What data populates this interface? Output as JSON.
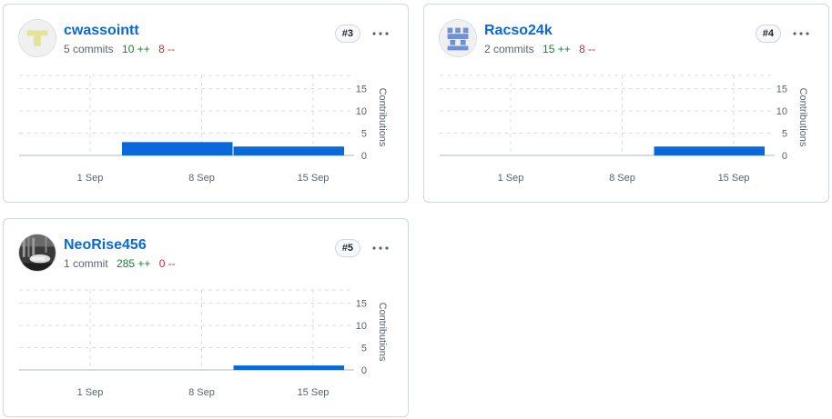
{
  "x_ticks": [
    "1 Sep",
    "8 Sep",
    "15 Sep"
  ],
  "y_ticks": [
    0,
    5,
    10,
    15
  ],
  "y_axis_title": "Contributions",
  "ylim": [
    0,
    18
  ],
  "colors": {
    "bar": "#0969da",
    "link": "#0969da",
    "additions": "#1a7f37",
    "deletions": "#d1242f"
  },
  "contributors": [
    {
      "name": "cwassointt",
      "commits": "5 commits",
      "additions": "10 ++",
      "deletions": "8 --",
      "rank": "#3",
      "avatar_icon": "yellow-identicon",
      "chart_data": {
        "type": "bar",
        "x_ticks": [
          "1 Sep",
          "8 Sep",
          "15 Sep"
        ],
        "y_ticks": [
          0,
          5,
          10,
          15
        ],
        "ylabel": "Contributions",
        "bins": [
          {
            "start_day": 3,
            "end_day": 10,
            "value": 3
          },
          {
            "start_day": 10,
            "end_day": 17,
            "value": 2
          }
        ]
      }
    },
    {
      "name": "Racso24k",
      "commits": "2 commits",
      "additions": "15 ++",
      "deletions": "8 --",
      "rank": "#4",
      "avatar_icon": "blue-identicon",
      "chart_data": {
        "type": "bar",
        "x_ticks": [
          "1 Sep",
          "8 Sep",
          "15 Sep"
        ],
        "y_ticks": [
          0,
          5,
          10,
          15
        ],
        "ylabel": "Contributions",
        "bins": [
          {
            "start_day": 10,
            "end_day": 17,
            "value": 2
          }
        ]
      }
    },
    {
      "name": "NeoRise456",
      "commits": "1 commit",
      "additions": "285 ++",
      "deletions": "0 --",
      "rank": "#5",
      "avatar_icon": "photo-avatar",
      "chart_data": {
        "type": "bar",
        "x_ticks": [
          "1 Sep",
          "8 Sep",
          "15 Sep"
        ],
        "y_ticks": [
          0,
          5,
          10,
          15
        ],
        "ylabel": "Contributions",
        "bins": [
          {
            "start_day": 10,
            "end_day": 17,
            "value": 1
          }
        ]
      }
    }
  ]
}
